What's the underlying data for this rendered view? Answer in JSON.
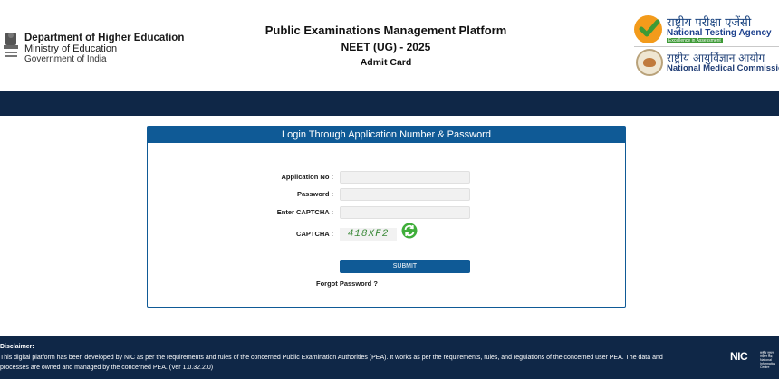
{
  "header": {
    "left": {
      "line1": "Department of Higher Education",
      "line2": "Ministry of Education",
      "line3": "Government of India"
    },
    "center": {
      "platform": "Public Examinations Management Platform",
      "exam": "NEET (UG) - 2025",
      "doc": "Admit Card"
    },
    "nta": {
      "hindi": "राष्ट्रीय परीक्षा एजेंसी",
      "english": "National Testing Agency",
      "tagline": "Excellence in Assessment"
    },
    "nmc": {
      "hindi": "राष्ट्रीय आयुर्विज्ञान आयोग",
      "english": "National Medical Commission"
    }
  },
  "login": {
    "title": "Login Through Application Number & Password",
    "application_no_label": "Application No :",
    "application_no_value": "",
    "password_label": "Password :",
    "password_value": "",
    "enter_captcha_label": "Enter CAPTCHA :",
    "enter_captcha_value": "",
    "captcha_label": "CAPTCHA :",
    "captcha_text": "418XF2",
    "submit_label": "SUBMIT",
    "forgot_label": "Forgot Password ?"
  },
  "footer": {
    "disclaimer_title": "Disclaimer:",
    "disclaimer_text": "This digital platform has been developed by NIC as per the requirements and rules of the concerned Public Examination Authorities (PEA). It works as per the requirements, rules, and regulations of the concerned user PEA. The data and processes are owned and managed by the concerned PEA. (Ver 1.0.32.2.0)",
    "nic_logo_text": "NIC",
    "nic_hindi_small": "राष्ट्रीय सूचना विज्ञान केंद्र",
    "nic_small": "National Informatics Centre"
  },
  "colors": {
    "navy": "#0f2747",
    "panel_blue": "#0f5a96",
    "nta_orange": "#f39b1b",
    "nta_green": "#3d9a36",
    "captcha_green": "#3c8a3a"
  }
}
